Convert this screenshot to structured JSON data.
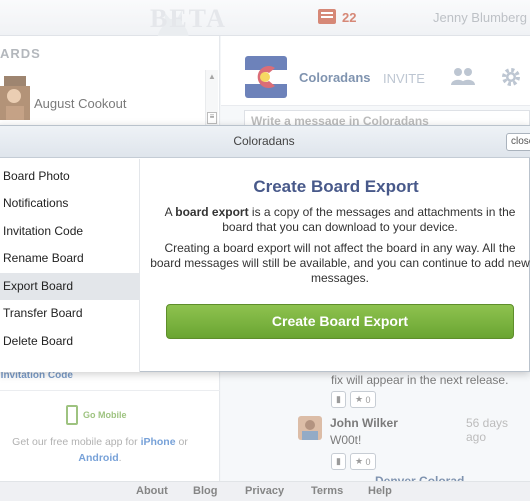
{
  "topbar": {
    "logo_text": "BETA",
    "inbox_count": "22",
    "user_name": "Jenny Blumberg"
  },
  "sidebar": {
    "boards_title": "ARDS",
    "board_item": "August Cookout",
    "invite_code_link": "r Invitation Code",
    "go_mobile": "Go Mobile",
    "promo_prefix": "Get our free mobile app for ",
    "promo_iphone": "iPhone",
    "promo_or": " or",
    "promo_android": "Android",
    "promo_end": "."
  },
  "board": {
    "title": "Coloradans",
    "invite": "INVITE",
    "message_placeholder": "Write a message in Coloradans"
  },
  "feed": {
    "post_text": "fix will appear in the next release.",
    "like_count_1": "0",
    "author": "John Wilker",
    "time": "56 days ago",
    "body": "W00t!",
    "like_count_2": "0",
    "partial_name": "Denver Colorad"
  },
  "footer": {
    "links": [
      "About",
      "Blog",
      "Privacy",
      "Terms",
      "Help"
    ]
  },
  "modal": {
    "title": "Coloradans",
    "close_label": "close",
    "menu": [
      "Board Photo",
      "Notifications",
      "Invitation Code",
      "Rename Board",
      "Export Board",
      "Transfer Board",
      "Delete Board"
    ],
    "active_item": "Export Board",
    "heading": "Create Board Export",
    "desc_prefix": "A ",
    "desc_bold": "board export",
    "desc_rest": " is a copy of the messages and attachments in the board that you can download to your device.",
    "note": "Creating a board export will not affect the board in any way. All the board messages will still be available, and you can continue to add new messages.",
    "button_label": "Create Board Export"
  },
  "colors": {
    "accent_green": "#6aa532",
    "title_blue": "#48598a",
    "link_blue": "#2e6fc4",
    "inbox_red": "#c0492e"
  }
}
